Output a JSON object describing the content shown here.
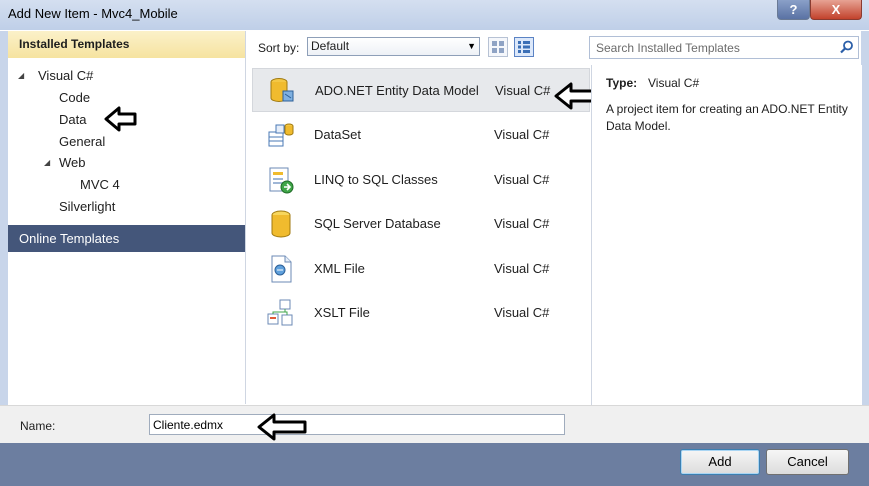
{
  "window": {
    "title": "Add New Item - Mvc4_Mobile",
    "help_label": "?",
    "close_label": "X"
  },
  "left_pane": {
    "installed_header": "Installed Templates",
    "tree": [
      {
        "label": "Visual C#",
        "expanded": true
      },
      {
        "label": "Code"
      },
      {
        "label": "Data",
        "selected": true
      },
      {
        "label": "General"
      },
      {
        "label": "Web",
        "expanded": true
      },
      {
        "label": "MVC 4"
      },
      {
        "label": "Silverlight"
      }
    ],
    "online_header": "Online Templates"
  },
  "toolbar": {
    "sort_label": "Sort by:",
    "sort_value": "Default",
    "search_placeholder": "Search Installed Templates"
  },
  "templates": [
    {
      "name": "ADO.NET Entity Data Model",
      "language": "Visual C#",
      "icon": "entity-model-icon",
      "selected": true
    },
    {
      "name": "DataSet",
      "language": "Visual C#",
      "icon": "dataset-icon"
    },
    {
      "name": "LINQ to SQL Classes",
      "language": "Visual C#",
      "icon": "linq-icon"
    },
    {
      "name": "SQL Server Database",
      "language": "Visual C#",
      "icon": "database-icon"
    },
    {
      "name": "XML File",
      "language": "Visual C#",
      "icon": "xml-file-icon"
    },
    {
      "name": "XSLT File",
      "language": "Visual C#",
      "icon": "xslt-file-icon"
    }
  ],
  "details": {
    "type_label": "Type:",
    "type_value": "Visual C#",
    "description": "A project item for creating an ADO.NET Entity Data Model."
  },
  "name_field": {
    "label": "Name:",
    "value": "Cliente.edmx"
  },
  "buttons": {
    "add": "Add",
    "cancel": "Cancel"
  },
  "colors": {
    "selection_header": "#f6e3a0",
    "online_header": "#44567a",
    "button_bar": "#6c7ea0"
  }
}
